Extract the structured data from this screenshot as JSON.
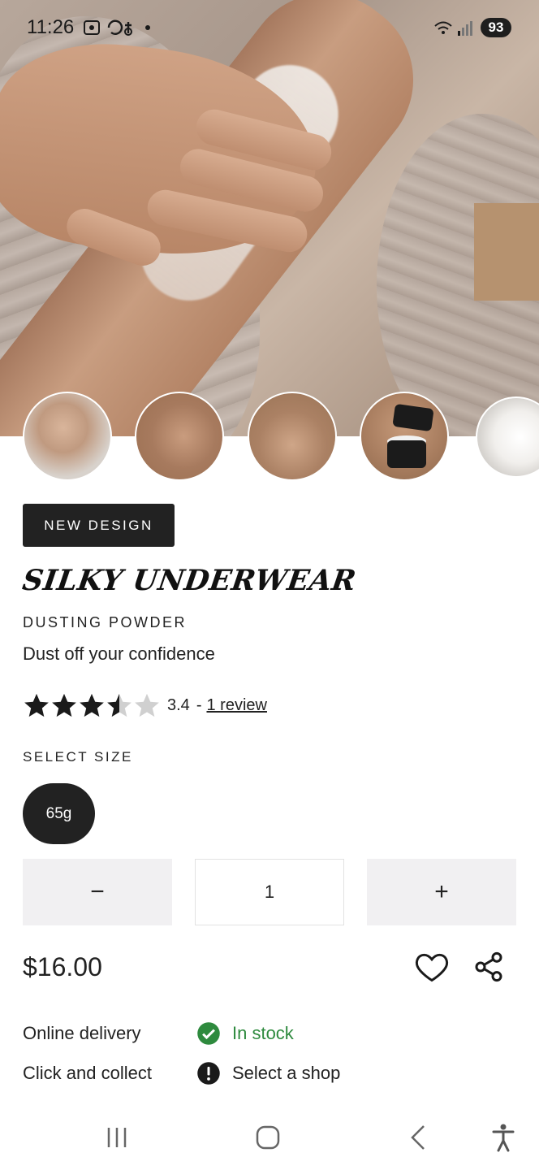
{
  "status_bar": {
    "time": "11:26",
    "battery": "93"
  },
  "product": {
    "badge": "NEW DESIGN",
    "name": "SILKY UNDERWEAR",
    "category": "DUSTING POWDER",
    "tagline": "Dust off your confidence",
    "rating_value": "3.4",
    "rating_separator": "-",
    "review_link": "1 review",
    "rating_stars": 3.4,
    "size_label": "SELECT SIZE",
    "sizes": [
      "65g"
    ],
    "selected_size": "65g",
    "quantity": "1",
    "minus_symbol": "−",
    "plus_symbol": "+",
    "price": "$16.00"
  },
  "availability": [
    {
      "label": "Online delivery",
      "status": "In stock",
      "icon": "check-circle-icon",
      "color": "#2e8a3e"
    },
    {
      "label": "Click and collect",
      "status": "Select a shop",
      "icon": "alert-circle-icon",
      "color": "#1a1a1a"
    }
  ],
  "colors": {
    "accent_dark": "#222222",
    "in_stock_green": "#2e8a3e",
    "button_bg": "#f1f0f2"
  },
  "icons": [
    "heart-icon",
    "share-icon",
    "recent-apps-icon",
    "home-icon",
    "back-icon",
    "accessibility-icon"
  ]
}
